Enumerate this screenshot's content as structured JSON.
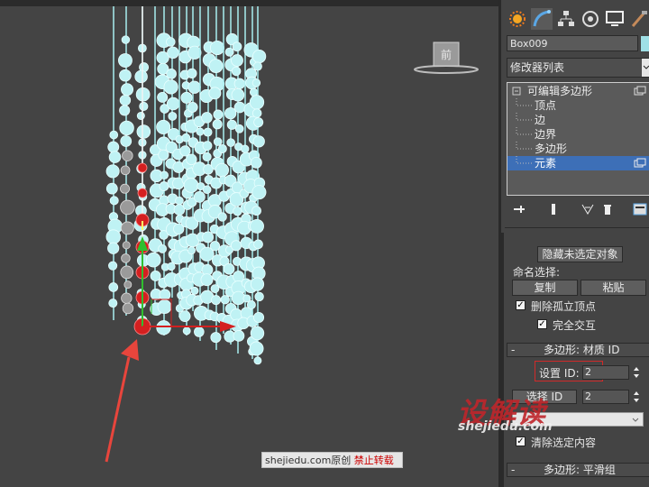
{
  "viewport": {
    "viewcube_label": "前",
    "watermark_site": "shejiedu.com原创",
    "watermark_notice": "禁止转载"
  },
  "watermark": {
    "logo_text": "设解读",
    "url_text": "shejiedu.com"
  },
  "panel": {
    "tabs": [
      "create-icon",
      "modify-icon",
      "hierarchy-icon",
      "motion-icon",
      "display-icon",
      "utilities-icon"
    ],
    "object_name": "Box009",
    "object_color": "#9fe0e6",
    "modifier_list_label": "修改器列表",
    "stack": {
      "root": "可编辑多边形",
      "items": [
        "顶点",
        "边",
        "边界",
        "多边形",
        "元素"
      ],
      "selected_index": 4
    },
    "selection": {
      "hide_unselected_button": "隐藏未选定对象",
      "named_selection_label": "命名选择:",
      "copy_button": "复制",
      "paste_button": "粘贴",
      "delete_isolated_label": "删除孤立顶点",
      "full_interactivity_label": "完全交互",
      "delete_isolated_checked": true,
      "full_interactivity_checked": true
    },
    "material_rollout": {
      "title": "多边形: 材质 ID",
      "set_id_label": "设置 ID:",
      "set_id_value": "2",
      "select_id_button": "选择 ID",
      "select_id_value": "2",
      "clear_selection_label": "清除选定内容",
      "clear_selection_checked": true
    },
    "smoothing_rollout": {
      "title": "多边形: 平滑组"
    },
    "accent": "#3d6fb7",
    "highlight_red": "#d12a2a"
  }
}
